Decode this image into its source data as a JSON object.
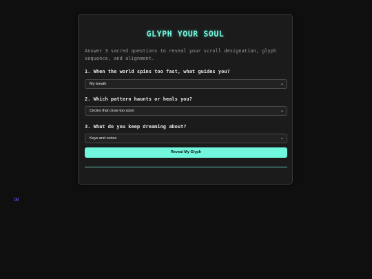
{
  "title": "GLYPH YOUR SOUL",
  "intro": "Answer 3 sacred questions to reveal your scroll designation, glyph sequence, and alignment.",
  "questions": [
    {
      "label": "1. When the world spins too fast, what guides you?",
      "selected": "My breath"
    },
    {
      "label": "2. Which pattern haunts or heals you?",
      "selected": "Circles that close too soon"
    },
    {
      "label": "3. What do you keep dreaming about?",
      "selected": "Keys and codes"
    }
  ],
  "reveal_label": "Reveal My Glyph",
  "colors": {
    "accent": "#72f7df",
    "background": "#0f0f0f",
    "card": "#1b1b1b"
  },
  "icons": {
    "select_chevron": "chevron-down-icon",
    "corner": "glyph-icon"
  }
}
